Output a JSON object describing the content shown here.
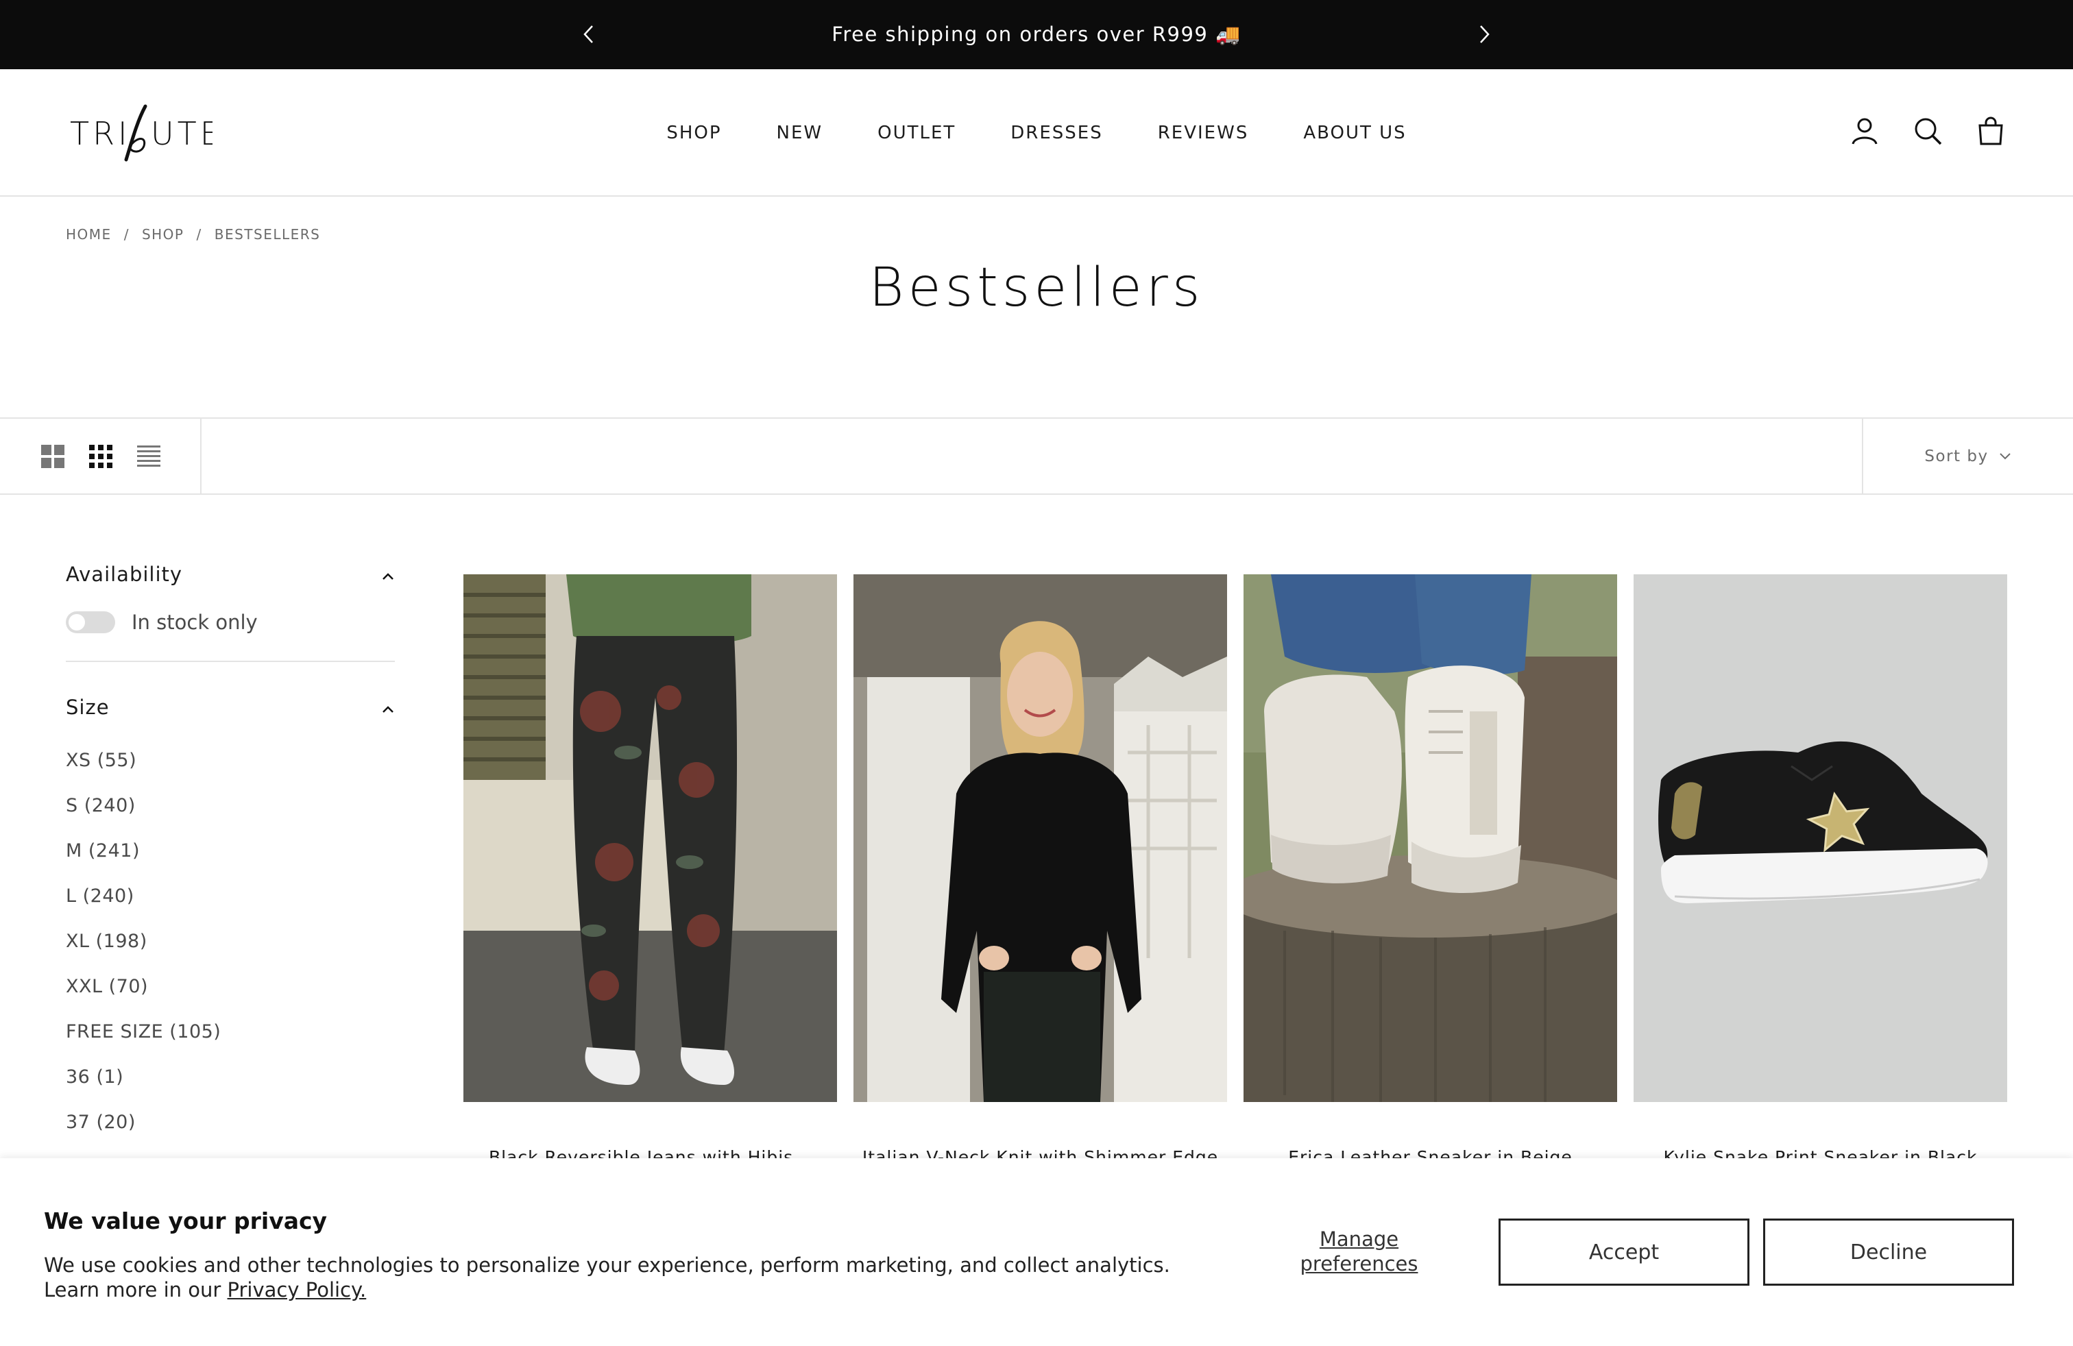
{
  "announcement": {
    "text": "Free shipping on orders over R999 🚚",
    "icons": {
      "prev": "chevron-left-icon",
      "next": "chevron-right-icon"
    }
  },
  "header": {
    "logo_text": "TRIBUTE",
    "nav": [
      "SHOP",
      "NEW",
      "OUTLET",
      "DRESSES",
      "REVIEWS",
      "ABOUT US"
    ],
    "icons": [
      "account-icon",
      "search-icon",
      "bag-icon"
    ]
  },
  "breadcrumb": {
    "items": [
      "HOME",
      "SHOP",
      "BESTSELLERS"
    ],
    "separator": "/"
  },
  "page": {
    "title": "Bestsellers"
  },
  "toolbar": {
    "layout_icons": [
      "grid-2-icon",
      "grid-4-icon",
      "list-icon"
    ],
    "sort_label": "Sort by"
  },
  "filters": {
    "availability": {
      "title": "Availability",
      "toggle_label": "In stock only"
    },
    "size": {
      "title": "Size",
      "options": [
        "XS (55)",
        "S (240)",
        "M (241)",
        "L (240)",
        "XL (198)",
        "XXL (70)",
        "FREE SIZE (105)",
        "36 (1)",
        "37 (20)"
      ]
    }
  },
  "products": [
    {
      "title": "Black Reversible Jeans with Hibis..."
    },
    {
      "title": "Italian V-Neck Knit with Shimmer Edge"
    },
    {
      "title": "Erica Leather Sneaker in Beige"
    },
    {
      "title": "Kylie Snake Print Sneaker in Black"
    }
  ],
  "cookie": {
    "title": "We value your privacy",
    "text": "We use cookies and other technologies to personalize your experience, perform marketing, and collect analytics.",
    "learn_more": "Learn more in our ",
    "policy_link": "Privacy Policy.",
    "manage_label": "Manage preferences",
    "accept_label": "Accept",
    "decline_label": "Decline"
  },
  "colors": {
    "announcement_bg": "#0c0c0c",
    "text": "#1c1c1c",
    "muted": "#6b6b6b",
    "border": "#e4e4e4"
  }
}
